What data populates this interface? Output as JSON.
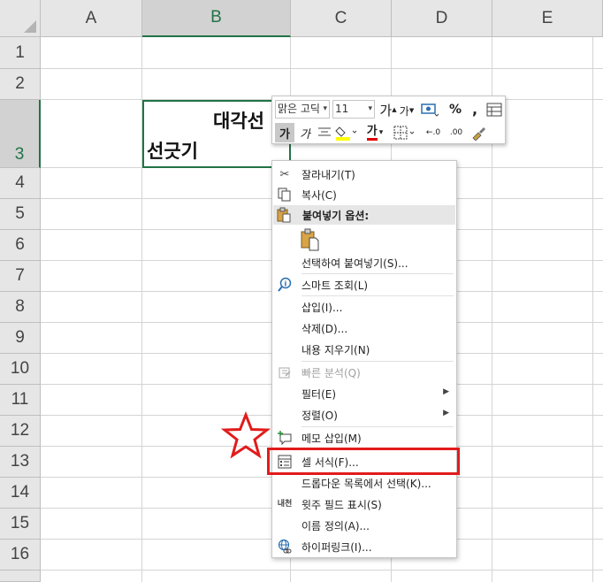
{
  "sheet": {
    "columns": [
      "A",
      "B",
      "C",
      "D",
      "E"
    ],
    "rows": [
      "1",
      "2",
      "3",
      "4",
      "5",
      "6",
      "7",
      "8",
      "9",
      "10",
      "11",
      "12",
      "13",
      "14",
      "15",
      "16"
    ],
    "selected_column": "B",
    "selected_row": "3",
    "cell_b3": {
      "line1": "대각선",
      "line2": "선긋기"
    }
  },
  "mini_toolbar": {
    "font_name": "맑은 고딕",
    "font_size": "11",
    "grow_font": "가",
    "shrink_font": "가",
    "percent": "%",
    "comma": ",",
    "bold": "가",
    "italic": "가",
    "font_color": "가",
    "inc_decimal": "←.0",
    "dec_decimal": ".00",
    "colors": {
      "fill": "#ffff00",
      "font": "#e00000"
    }
  },
  "context_menu": {
    "cut": "잘라내기(T)",
    "copy": "복사(C)",
    "paste_options": "붙여넣기 옵션:",
    "paste_special": "선택하여 붙여넣기(S)...",
    "smart_lookup": "스마트 조회(L)",
    "insert": "삽입(I)...",
    "delete": "삭제(D)...",
    "clear_contents": "내용 지우기(N)",
    "quick_analysis": "빠른 분석(Q)",
    "filter": "필터(E)",
    "sort": "정렬(O)",
    "insert_comment": "메모 삽입(M)",
    "format_cells": "셀 서식(F)...",
    "pick_from_dropdown": "드롭다운 목록에서 선택(K)...",
    "phonetic": "윗주 필드 표시(S)",
    "define_name": "이름 정의(A)...",
    "hyperlink": "하이퍼링크(I)...",
    "phonetic_icon_text": "내천"
  },
  "annotation_colors": {
    "highlight": "#e21b1b"
  }
}
